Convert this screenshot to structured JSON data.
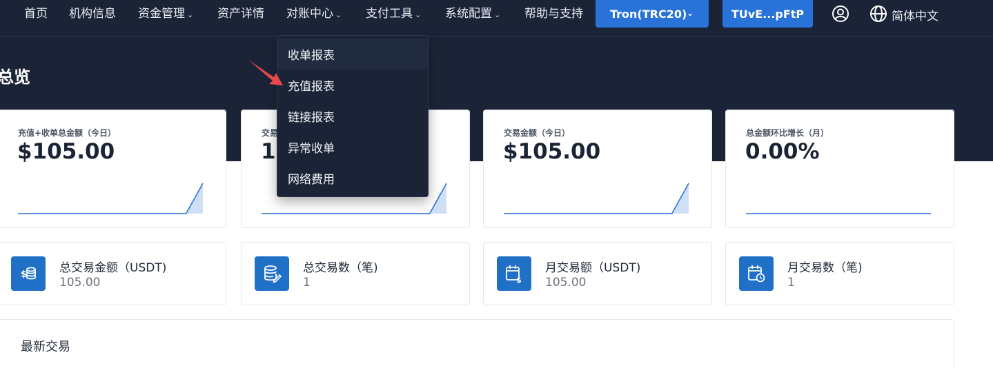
{
  "nav": {
    "items": [
      {
        "label": "首页",
        "has_chevron": false
      },
      {
        "label": "机构信息",
        "has_chevron": false
      },
      {
        "label": "资金管理",
        "has_chevron": true
      },
      {
        "label": "资产详情",
        "has_chevron": false
      },
      {
        "label": "对账中心",
        "has_chevron": true
      },
      {
        "label": "支付工具",
        "has_chevron": true
      },
      {
        "label": "系统配置",
        "has_chevron": true
      },
      {
        "label": "帮助与支持",
        "has_chevron": false
      }
    ],
    "network_select": "Tron(TRC20)",
    "address_button": "TUvE...pFtP",
    "language": "简体中文",
    "chevron": "⌄",
    "icons": {
      "user": "user-circle-icon",
      "globe": "globe-icon"
    }
  },
  "page": {
    "title": "总览"
  },
  "dropdown": {
    "items": [
      "收单报表",
      "充值报表",
      "链接报表",
      "异常收单",
      "网络费用"
    ],
    "hovered_index": 0,
    "pointer_target_index": 1
  },
  "stat_cards": [
    {
      "label": "充值+收单总金额（今日）",
      "value": "$105.00",
      "spark": [
        0,
        0,
        0,
        0,
        0,
        0,
        0,
        0,
        0,
        0,
        0,
        105
      ]
    },
    {
      "label": "交易",
      "value": "1",
      "spark": [
        0,
        0,
        0,
        0,
        0,
        0,
        0,
        0,
        0,
        0,
        0,
        1
      ]
    },
    {
      "label": "交易金额（今日）",
      "value": "$105.00",
      "spark": [
        0,
        0,
        0,
        0,
        0,
        0,
        0,
        0,
        0,
        0,
        0,
        105
      ]
    },
    {
      "label": "总金额环比增长（月）",
      "value": "0.00%",
      "spark": [
        0,
        0,
        0,
        0,
        0,
        0,
        0,
        0,
        0,
        0,
        0,
        0
      ]
    }
  ],
  "summary_cards": [
    {
      "title": "总交易金额（USDT)",
      "value": "105.00",
      "icon": "dollar-coins-icon"
    },
    {
      "title": "总交易数（笔)",
      "value": "1",
      "icon": "database-edit-icon"
    },
    {
      "title": "月交易额（USDT)",
      "value": "105.00",
      "icon": "calendar-dollar-icon"
    },
    {
      "title": "月交易数（笔)",
      "value": "1",
      "icon": "calendar-clock-icon"
    }
  ],
  "latest": {
    "title": "最新交易"
  },
  "colors": {
    "header_bg": "#1b2437",
    "accent": "#2872d8",
    "icon_tile": "#2170c8",
    "spark_line": "#2a6fd6",
    "spark_fill": "#cfe0f6",
    "pointer_arrow": "#e8484a"
  }
}
